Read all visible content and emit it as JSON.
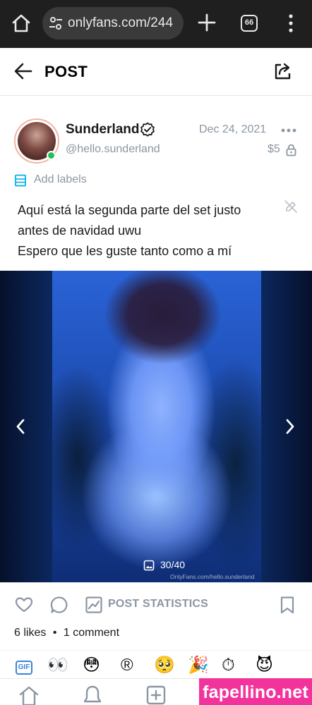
{
  "browser": {
    "url": "onlyfans.com/244",
    "tab_count": "66",
    "icons": [
      "home-icon",
      "site-settings-icon",
      "new-tab-icon",
      "tabs-icon",
      "menu-icon"
    ]
  },
  "header": {
    "title": "POST",
    "icons": [
      "back-arrow-icon",
      "share-icon"
    ]
  },
  "post": {
    "author": {
      "name": "Sunderland",
      "handle": "@hello.sunderland",
      "verified": true,
      "online": true
    },
    "date": "Dec 24, 2021",
    "price": "$5",
    "labels_text": "Add labels",
    "caption": [
      "Aquí está la segunda parte del set justo",
      "antes de navidad uwu",
      "Espero que les guste tanto como a mí"
    ],
    "media": {
      "counter": "30/40",
      "watermark": "OnlyFans.com/hello.sunderland"
    },
    "statistics_label": "POST STATISTICS",
    "likes": "6 likes",
    "separator": "•",
    "comments": "1 comment"
  },
  "reactions": {
    "gif_label": "GIF",
    "items": [
      "👀",
      "😳",
      "®",
      "🥺",
      "🎉",
      "⏱",
      "😈"
    ]
  },
  "bottom_nav": {
    "items": [
      "home-icon",
      "notifications-icon",
      "add-post-icon"
    ]
  },
  "promo": {
    "text": "fapellino.net",
    "color": "#f3339c"
  },
  "colors": {
    "accent": "#00aff0",
    "muted": "#8a96a3",
    "online": "#21c05b"
  }
}
